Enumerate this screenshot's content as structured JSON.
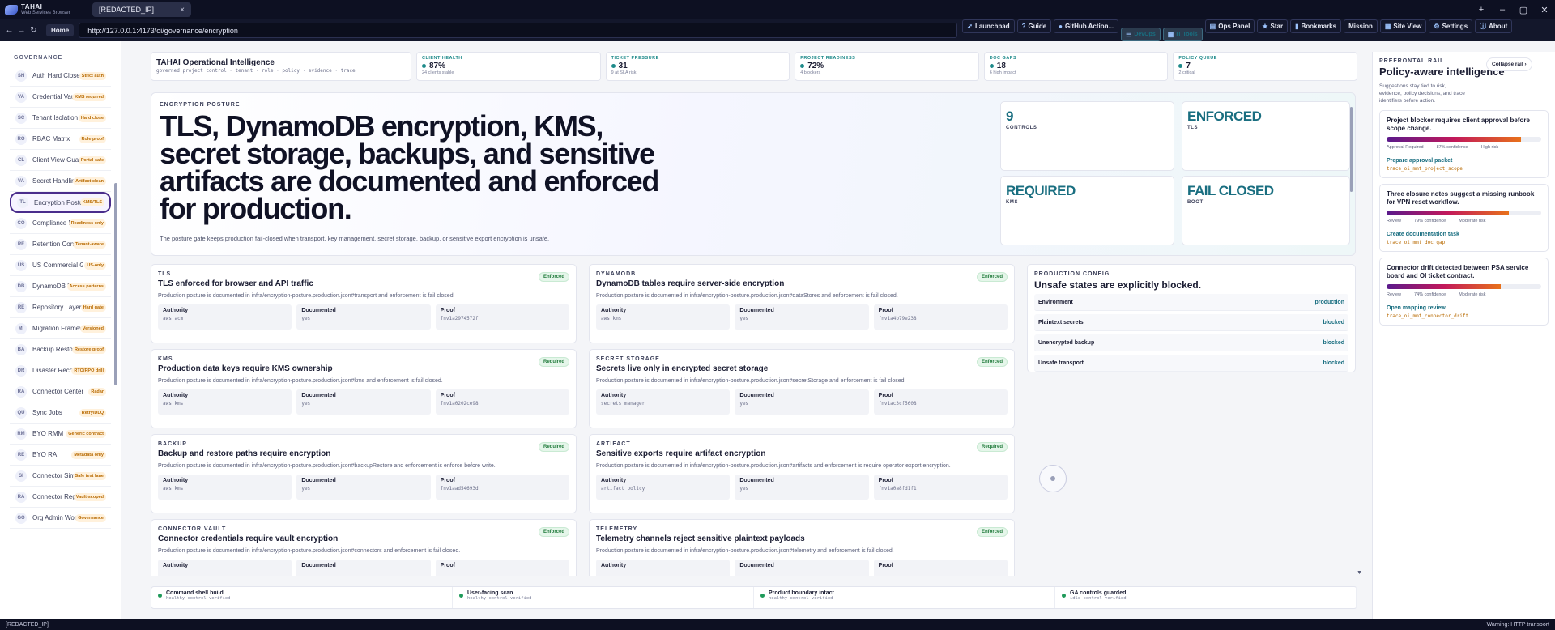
{
  "app": {
    "brand": "TAHAI",
    "brand_sub": "Web Services Browser",
    "tab_title": "[REDACTED_IP]"
  },
  "nav": {
    "home": "Home",
    "url": "http://127.0.0.1:4173/oi/governance/encryption",
    "tools": [
      {
        "label": "Launchpad",
        "icon": "rocket-icon",
        "active": false
      },
      {
        "label": "Guide",
        "icon": "help-icon",
        "active": false
      },
      {
        "label": "GitHub Action...",
        "icon": "github-icon",
        "active": false
      },
      {
        "label": "DevOps",
        "icon": "menu-icon",
        "active": true
      },
      {
        "label": "IT Tools",
        "icon": "grid-icon",
        "active": true
      },
      {
        "label": "Ops Panel",
        "icon": "panel-icon",
        "active": false
      },
      {
        "label": "Star",
        "icon": "star-icon",
        "active": false
      },
      {
        "label": "Bookmarks",
        "icon": "bookmark-icon",
        "active": false
      },
      {
        "label": "Mission",
        "icon": "",
        "active": false
      },
      {
        "label": "Site View",
        "icon": "grid-icon",
        "active": false
      },
      {
        "label": "Settings",
        "icon": "gear-icon",
        "active": false
      },
      {
        "label": "About",
        "icon": "info-icon",
        "active": false
      }
    ]
  },
  "sidebar": {
    "heading": "GOVERNANCE",
    "items": [
      {
        "abbr": "SH",
        "label": "Auth Hard Close",
        "badge": "Strict auth"
      },
      {
        "abbr": "VA",
        "label": "Credential Vault",
        "badge": "KMS required"
      },
      {
        "abbr": "SC",
        "label": "Tenant Isolation",
        "badge": "Hard close"
      },
      {
        "abbr": "RO",
        "label": "RBAC Matrix",
        "badge": "Role proof"
      },
      {
        "abbr": "CL",
        "label": "Client View Guard",
        "badge": "Portal safe"
      },
      {
        "abbr": "VA",
        "label": "Secret Handling",
        "badge": "Artifact clean"
      },
      {
        "abbr": "TL",
        "label": "Encryption Posture",
        "badge": "KMS/TLS"
      },
      {
        "abbr": "CO",
        "label": "Compliance Ma...",
        "badge": "Readiness only"
      },
      {
        "abbr": "RE",
        "label": "Retention Contr...",
        "badge": "Tenant-aware"
      },
      {
        "abbr": "US",
        "label": "US Commercial Gate",
        "badge": "US-only"
      },
      {
        "abbr": "DB",
        "label": "DynamoDB De...",
        "badge": "Access patterns"
      },
      {
        "abbr": "RE",
        "label": "Repository Layer",
        "badge": "Hard gate"
      },
      {
        "abbr": "MI",
        "label": "Migration Framewo...",
        "badge": "Versioned"
      },
      {
        "abbr": "BA",
        "label": "Backup Restore",
        "badge": "Restore proof"
      },
      {
        "abbr": "DR",
        "label": "Disaster Recovery",
        "badge": "RTO/RPO drill"
      },
      {
        "abbr": "RA",
        "label": "Connector Center",
        "badge": "Radar"
      },
      {
        "abbr": "QU",
        "label": "Sync Jobs",
        "badge": "Retry/DLQ"
      },
      {
        "abbr": "RM",
        "label": "BYO RMM",
        "badge": "Generic contract"
      },
      {
        "abbr": "RE",
        "label": "BYO RA",
        "badge": "Metadata only"
      },
      {
        "abbr": "SI",
        "label": "Connector Simul...",
        "badge": "Safe test lane"
      },
      {
        "abbr": "RA",
        "label": "Connector Regist...",
        "badge": "Vault-scoped"
      },
      {
        "abbr": "GO",
        "label": "Org Admin Workfl...",
        "badge": "Governance"
      }
    ]
  },
  "summary": {
    "title": "TAHAI Operational Intelligence",
    "subtitle": "governed project control · tenant · role · policy · evidence · trace",
    "cards": [
      {
        "label": "CLIENT HEALTH",
        "value": "87%",
        "sub": "24 clients stable"
      },
      {
        "label": "TICKET PRESSURE",
        "value": "31",
        "sub": "9 at SLA risk"
      },
      {
        "label": "PROJECT READINESS",
        "value": "72%",
        "sub": "4 blockers"
      },
      {
        "label": "DOC GAPS",
        "value": "18",
        "sub": "6 high impact"
      },
      {
        "label": "POLICY QUEUE",
        "value": "7",
        "sub": "2 critical"
      }
    ]
  },
  "hero": {
    "kicker": "ENCRYPTION POSTURE",
    "headline": "TLS, DynamoDB encryption, KMS, secret storage, backups, and sensitive artifacts are documented and enforced for production.",
    "desc": "The posture gate keeps production fail-closed when transport, key management, secret storage, backup, or sensitive export encryption is unsafe.",
    "stats": [
      {
        "value": "9",
        "label": "CONTROLS"
      },
      {
        "value": "ENFORCED",
        "label": "TLS"
      },
      {
        "value": "REQUIRED",
        "label": "KMS"
      },
      {
        "value": "FAIL CLOSED",
        "label": "BOOT"
      }
    ]
  },
  "controls": [
    {
      "kicker": "TLS",
      "title": "TLS enforced for browser and API traffic",
      "badge": "Enforced",
      "desc": "Production posture is documented in infra/encryption-posture.production.json#transport and enforcement is fail closed.",
      "authority": "aws acm",
      "documented": "yes",
      "proof": "fnv1a2974572f"
    },
    {
      "kicker": "DYNAMODB",
      "title": "DynamoDB tables require server-side encryption",
      "badge": "Enforced",
      "desc": "Production posture is documented in infra/encryption-posture.production.json#dataStores and enforcement is fail closed.",
      "authority": "aws kms",
      "documented": "yes",
      "proof": "fnv1a4b79e238"
    },
    {
      "kicker": "KMS",
      "title": "Production data keys require KMS ownership",
      "badge": "Required",
      "desc": "Production posture is documented in infra/encryption-posture.production.json#kms and enforcement is fail closed.",
      "authority": "aws kms",
      "documented": "yes",
      "proof": "fnv1a0202ce98"
    },
    {
      "kicker": "SECRET STORAGE",
      "title": "Secrets live only in encrypted secret storage",
      "badge": "Enforced",
      "desc": "Production posture is documented in infra/encryption-posture.production.json#secretStorage and enforcement is fail closed.",
      "authority": "secrets manager",
      "documented": "yes",
      "proof": "fnv1ac3cf5608"
    },
    {
      "kicker": "BACKUP",
      "title": "Backup and restore paths require encryption",
      "badge": "Required",
      "desc": "Production posture is documented in infra/encryption-posture.production.json#backupRestore and enforcement is enforce before write.",
      "authority": "aws kms",
      "documented": "yes",
      "proof": "fnv1aad54693d"
    },
    {
      "kicker": "ARTIFACT",
      "title": "Sensitive exports require artifact encryption",
      "badge": "Required",
      "desc": "Production posture is documented in infra/encryption-posture.production.json#artifacts and enforcement is require operator export encryption.",
      "authority": "artifact policy",
      "documented": "yes",
      "proof": "fnv1a0a8fd1f1"
    },
    {
      "kicker": "CONNECTOR VAULT",
      "title": "Connector credentials require vault encryption",
      "badge": "Enforced",
      "desc": "Production posture is documented in infra/encryption-posture.production.json#connectors and enforcement is fail closed.",
      "authority": "",
      "documented": "",
      "proof": ""
    },
    {
      "kicker": "TELEMETRY",
      "title": "Telemetry channels reject sensitive plaintext payloads",
      "badge": "Enforced",
      "desc": "Production posture is documented in infra/encryption-posture.production.json#telemetry and enforcement is fail closed.",
      "authority": "",
      "documented": "",
      "proof": ""
    }
  ],
  "field_labels": {
    "authority": "Authority",
    "documented": "Documented",
    "proof": "Proof"
  },
  "prod_config": {
    "kicker": "PRODUCTION CONFIG",
    "title": "Unsafe states are explicitly blocked.",
    "rows": [
      {
        "k": "Environment",
        "v": "production"
      },
      {
        "k": "Plaintext secrets",
        "v": "blocked"
      },
      {
        "k": "Unencrypted backup",
        "v": "blocked"
      },
      {
        "k": "Unsafe transport",
        "v": "blocked"
      }
    ]
  },
  "checks": [
    {
      "title": "Command shell build",
      "sub": "healthy control verified"
    },
    {
      "title": "User-facing scan",
      "sub": "healthy control verified"
    },
    {
      "title": "Product boundary intact",
      "sub": "healthy control verified"
    },
    {
      "title": "GA controls guarded",
      "sub": "idle control verified"
    }
  ],
  "rail": {
    "kicker": "PREFRONTAL RAIL",
    "title": "Policy-aware intelligence",
    "collapse": "Collapse rail",
    "desc": "Suggestions stay tied to risk, evidence, policy decisions, and trace identifiers before action.",
    "cards": [
      {
        "title": "Project blocker requires client approval before scope change.",
        "progress": 0.87,
        "m1": "Approval Required",
        "m2": "87% confidence",
        "m3": "High risk",
        "action": "Prepare approval packet",
        "trace": "trace_oi_mmt_project_scope"
      },
      {
        "title": "Three closure notes suggest a missing runbook for VPN reset workflow.",
        "progress": 0.79,
        "m1": "Review",
        "m2": "79% confidence",
        "m3": "Moderate risk",
        "action": "Create documentation task",
        "trace": "trace_oi_mmt_doc_gap"
      },
      {
        "title": "Connector drift detected between PSA service board and OI ticket contract.",
        "progress": 0.74,
        "m1": "Review",
        "m2": "74% confidence",
        "m3": "Moderate risk",
        "action": "Open mapping review",
        "trace": "trace_oi_mmt_connector_drift"
      }
    ]
  },
  "status": {
    "left": "[REDACTED_IP]",
    "right": "Warning: HTTP transport"
  }
}
